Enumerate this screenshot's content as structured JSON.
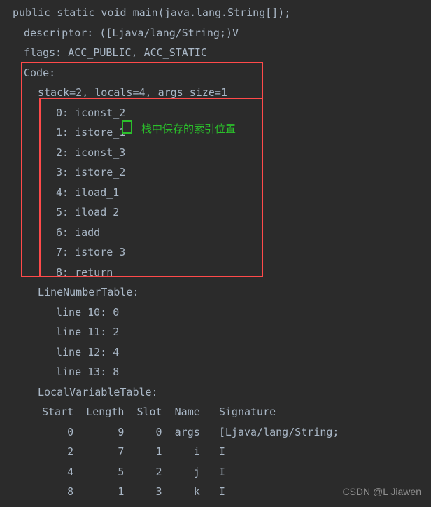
{
  "signature": "public static void main(java.lang.String[]);",
  "descriptor": "descriptor: ([Ljava/lang/String;)V",
  "flags": "flags: ACC_PUBLIC, ACC_STATIC",
  "code_header": "Code:",
  "stack_line": "stack=2, locals=4, args_size=1",
  "bytecode": [
    {
      "pc": "0",
      "instr": "iconst_2"
    },
    {
      "pc": "1",
      "instr": "istore_1"
    },
    {
      "pc": "2",
      "instr": "iconst_3"
    },
    {
      "pc": "3",
      "instr": "istore_2"
    },
    {
      "pc": "4",
      "instr": "iload_1"
    },
    {
      "pc": "5",
      "instr": "iload_2"
    },
    {
      "pc": "6",
      "instr": "iadd"
    },
    {
      "pc": "7",
      "instr": "istore_3"
    },
    {
      "pc": "8",
      "instr": "return"
    }
  ],
  "annotation_text": "栈中保存的索引位置",
  "lnt_header": "LineNumberTable:",
  "lnt": [
    "line 10: 0",
    "line 11: 2",
    "line 12: 4",
    "line 13: 8"
  ],
  "lvt_header": "LocalVariableTable:",
  "lvt_columns": "Start  Length  Slot  Name   Signature",
  "lvt_rows": [
    {
      "start": "0",
      "length": "9",
      "slot": "0",
      "name": "args",
      "sig": "[Ljava/lang/String;"
    },
    {
      "start": "2",
      "length": "7",
      "slot": "1",
      "name": "i",
      "sig": "I"
    },
    {
      "start": "4",
      "length": "5",
      "slot": "2",
      "name": "j",
      "sig": "I"
    },
    {
      "start": "8",
      "length": "1",
      "slot": "3",
      "name": "k",
      "sig": "I"
    }
  ],
  "watermark": "CSDN @L Jiawen"
}
